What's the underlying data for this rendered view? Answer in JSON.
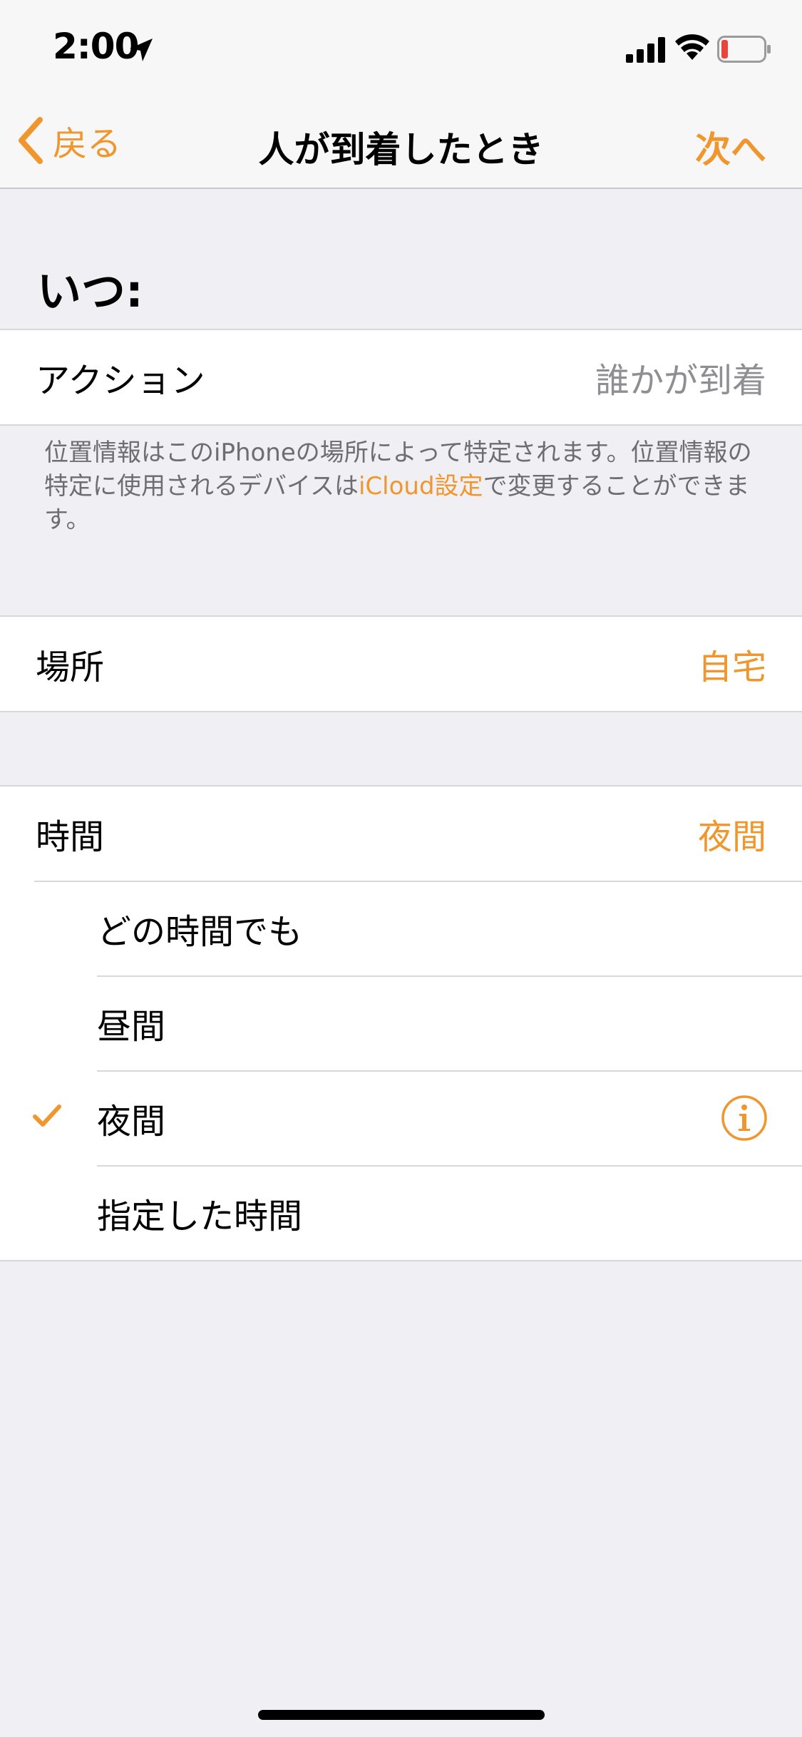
{
  "status_bar": {
    "time": "2:00",
    "icons": [
      "location-arrow-icon",
      "signal-icon",
      "wifi-icon",
      "battery-low-icon"
    ]
  },
  "nav": {
    "back_label": "戻る",
    "title": "人が到着したとき",
    "next_label": "次へ"
  },
  "section_header": "いつ:",
  "action_row": {
    "label": "アクション",
    "value": "誰かが到着"
  },
  "footer_note": {
    "text_before": "位置情報はこのiPhoneの場所によって特定されます。位置情報の特定に使用されるデバイスは",
    "link": "iCloud設定",
    "text_after": "で変更することができます。"
  },
  "location_row": {
    "label": "場所",
    "value": "自宅"
  },
  "time_row": {
    "label": "時間",
    "value": "夜間"
  },
  "time_options": [
    {
      "label": "どの時間でも",
      "selected": false
    },
    {
      "label": "昼間",
      "selected": false
    },
    {
      "label": "夜間",
      "selected": true
    },
    {
      "label": "指定した時間",
      "selected": false
    }
  ],
  "colors": {
    "accent": "#f0962c",
    "background": "#efeff4",
    "secondary_text": "#8e8e93"
  }
}
